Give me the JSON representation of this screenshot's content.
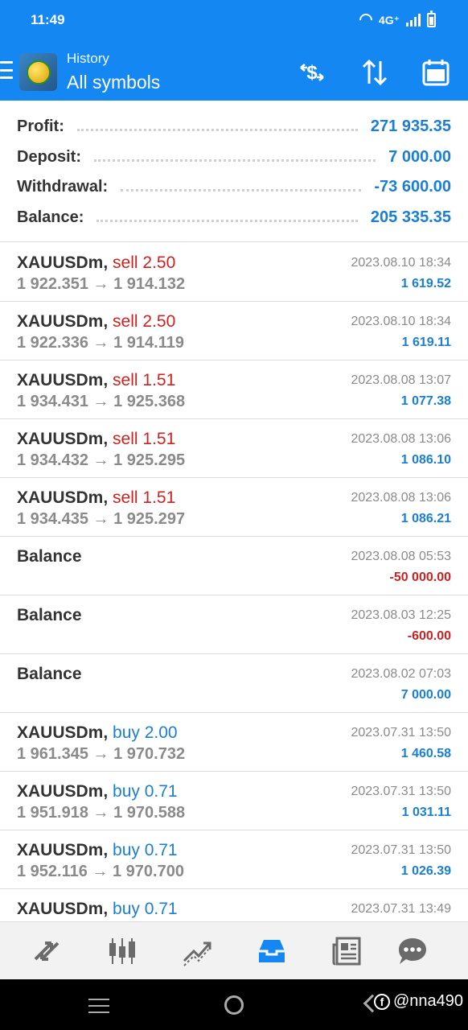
{
  "status_bar": {
    "time": "11:49",
    "network": "4G⁺"
  },
  "header": {
    "subtitle": "History",
    "title": "All symbols",
    "icons": [
      "menu-icon",
      "app-logo",
      "symbol-filter-icon",
      "sort-icon",
      "calendar-icon"
    ]
  },
  "summary": {
    "profit_label": "Profit:",
    "profit_value": "271 935.35",
    "deposit_label": "Deposit:",
    "deposit_value": "7 000.00",
    "withdrawal_label": "Withdrawal:",
    "withdrawal_value": "-73 600.00",
    "balance_label": "Balance:",
    "balance_value": "205 335.35"
  },
  "deals": [
    {
      "symbol": "XAUUSDm,",
      "action": "sell 2.50",
      "side": "sell",
      "prices": "1 922.351 → 1 914.132",
      "date": "2023.08.10 18:34",
      "amount": "1 619.52",
      "sign": "pos"
    },
    {
      "symbol": "XAUUSDm,",
      "action": "sell 2.50",
      "side": "sell",
      "prices": "1 922.336 → 1 914.119",
      "date": "2023.08.10 18:34",
      "amount": "1 619.11",
      "sign": "pos"
    },
    {
      "symbol": "XAUUSDm,",
      "action": "sell 1.51",
      "side": "sell",
      "prices": "1 934.431 → 1 925.368",
      "date": "2023.08.08 13:07",
      "amount": "1 077.38",
      "sign": "pos"
    },
    {
      "symbol": "XAUUSDm,",
      "action": "sell 1.51",
      "side": "sell",
      "prices": "1 934.432 → 1 925.295",
      "date": "2023.08.08 13:06",
      "amount": "1 086.10",
      "sign": "pos"
    },
    {
      "symbol": "XAUUSDm,",
      "action": "sell 1.51",
      "side": "sell",
      "prices": "1 934.435 → 1 925.297",
      "date": "2023.08.08 13:06",
      "amount": "1 086.21",
      "sign": "pos"
    },
    {
      "symbol": "Balance",
      "action": "",
      "side": "",
      "prices": "",
      "date": "2023.08.08 05:53",
      "amount": "-50 000.00",
      "sign": "neg"
    },
    {
      "symbol": "Balance",
      "action": "",
      "side": "",
      "prices": "",
      "date": "2023.08.03 12:25",
      "amount": "-600.00",
      "sign": "neg"
    },
    {
      "symbol": "Balance",
      "action": "",
      "side": "",
      "prices": "",
      "date": "2023.08.02 07:03",
      "amount": "7 000.00",
      "sign": "pos"
    },
    {
      "symbol": "XAUUSDm,",
      "action": "buy 2.00",
      "side": "buy",
      "prices": "1 961.345 → 1 970.732",
      "date": "2023.07.31 13:50",
      "amount": "1 460.58",
      "sign": "pos"
    },
    {
      "symbol": "XAUUSDm,",
      "action": "buy 0.71",
      "side": "buy",
      "prices": "1 951.918 → 1 970.588",
      "date": "2023.07.31 13:50",
      "amount": "1 031.11",
      "sign": "pos"
    },
    {
      "symbol": "XAUUSDm,",
      "action": "buy 0.71",
      "side": "buy",
      "prices": "1 952.116 → 1 970.700",
      "date": "2023.07.31 13:50",
      "amount": "1 026.39",
      "sign": "pos"
    },
    {
      "symbol": "XAUUSDm,",
      "action": "buy 0.71",
      "side": "buy",
      "prices": "",
      "date": "2023.07.31 13:49",
      "amount": "",
      "sign": "pos"
    }
  ],
  "bottom_nav": [
    "quotes-icon",
    "chart-icon",
    "trade-icon",
    "history-icon",
    "news-icon",
    "messages-icon"
  ],
  "watermark": "@nna490",
  "colors": {
    "primary": "#1487f3",
    "positive": "#1a7fd4",
    "negative": "#cc2222"
  }
}
